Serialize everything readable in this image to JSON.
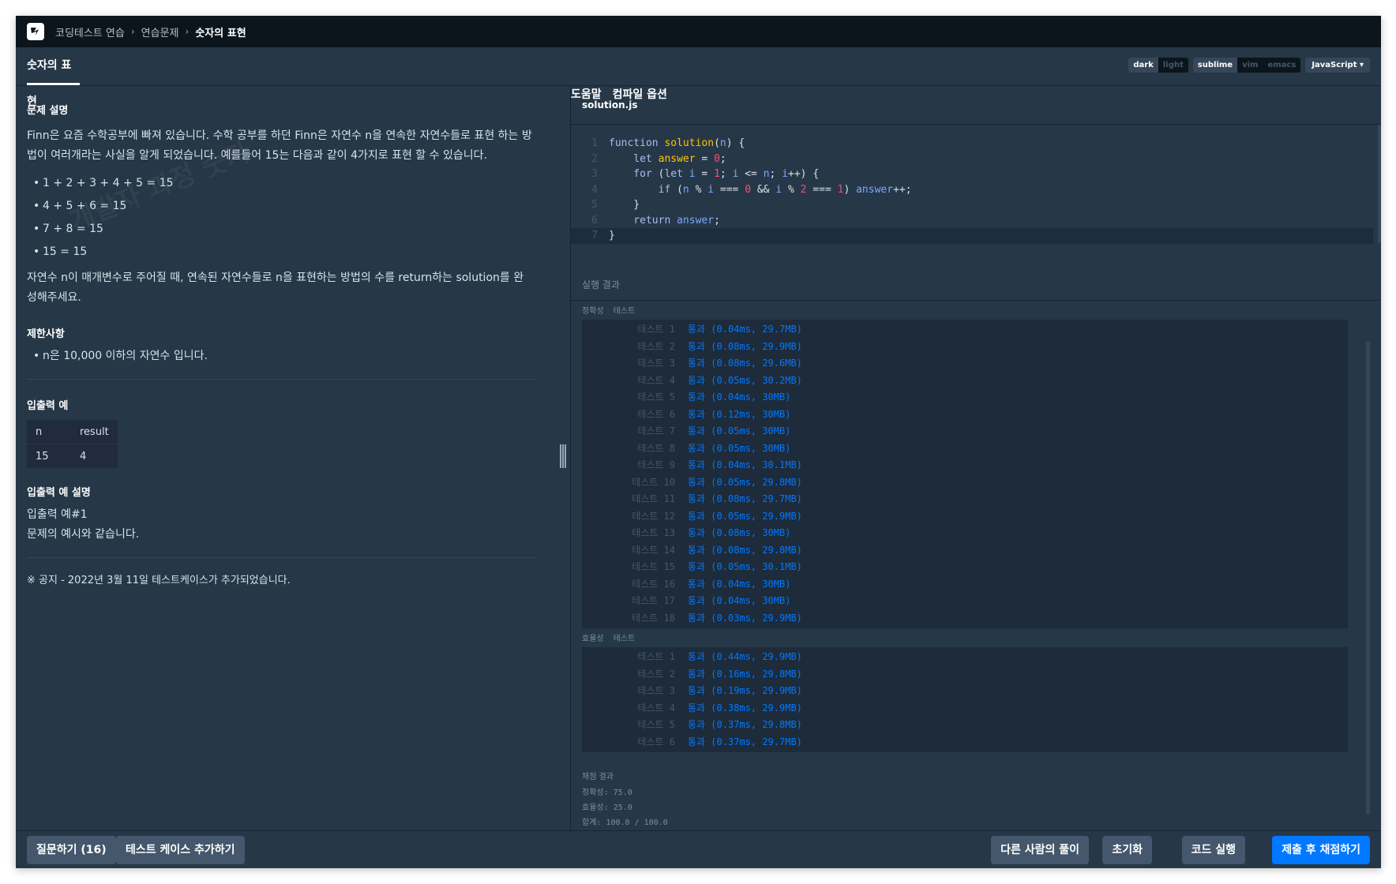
{
  "header": {
    "breadcrumbs": [
      "코딩테스트 연습",
      "연습문제",
      "숫자의 표현"
    ],
    "help": "도움말",
    "compile_options": "컴파일 옵션"
  },
  "tab": {
    "title": "숫자의 표현"
  },
  "editor_options": {
    "themes": [
      "dark",
      "light"
    ],
    "active_theme": "dark",
    "keymaps": [
      "sublime",
      "vim",
      "emacs"
    ],
    "active_keymap": "sublime",
    "language": "JavaScript"
  },
  "problem": {
    "desc_title": "문제 설명",
    "desc_text": "Finn은 요즘 수학공부에 빠져 있습니다. 수학 공부를 하던 Finn은 자연수 n을 연속한 자연수들로 표현 하는 방법이 여러개라는 사실을 알게 되었습니다. 예를들어 15는 다음과 같이 4가지로 표현 할 수 있습니다.",
    "examples": [
      "1 + 2 + 3 + 4 + 5 = 15",
      "4 + 5 + 6 = 15",
      "7 + 8 = 15",
      "15 = 15"
    ],
    "task_text": "자연수 n이 매개변수로 주어질 때, 연속된 자연수들로 n을 표현하는 방법의 수를 return하는 solution를 완성해주세요.",
    "constraints_title": "제한사항",
    "constraints": [
      "n은 10,000 이하의 자연수 입니다."
    ],
    "io_title": "입출력 예",
    "io_headers": [
      "n",
      "result"
    ],
    "io_rows": [
      [
        "15",
        "4"
      ]
    ],
    "io_explain_title": "입출력 예 설명",
    "io_explain_lines": [
      "입출력 예#1",
      "문제의 예시와 같습니다."
    ],
    "notice": "※ 공지 - 2022년 3월 11일 테스트케이스가 추가되었습니다."
  },
  "file": {
    "name": "solution.js"
  },
  "code_lines": [
    "function solution(n) {",
    "    let answer = 0;",
    "    for (let i = 1; i <= n; i++) {",
    "        if (n % i === 0 && i % 2 === 1) answer++;",
    "    }",
    "    return answer;",
    "}"
  ],
  "results": {
    "title": "실행 결과",
    "accuracy_label": [
      "정확성",
      "테스트"
    ],
    "efficiency_label": [
      "효율성",
      "테스트"
    ],
    "accuracy_tests": [
      {
        "label": "테스트 1",
        "result": "통과 (0.04ms, 29.7MB)"
      },
      {
        "label": "테스트 2",
        "result": "통과 (0.08ms, 29.9MB)"
      },
      {
        "label": "테스트 3",
        "result": "통과 (0.08ms, 29.6MB)"
      },
      {
        "label": "테스트 4",
        "result": "통과 (0.05ms, 30.2MB)"
      },
      {
        "label": "테스트 5",
        "result": "통과 (0.04ms, 30MB)"
      },
      {
        "label": "테스트 6",
        "result": "통과 (0.12ms, 30MB)"
      },
      {
        "label": "테스트 7",
        "result": "통과 (0.05ms, 30MB)"
      },
      {
        "label": "테스트 8",
        "result": "통과 (0.05ms, 30MB)"
      },
      {
        "label": "테스트 9",
        "result": "통과 (0.04ms, 30.1MB)"
      },
      {
        "label": "테스트 10",
        "result": "통과 (0.05ms, 29.8MB)"
      },
      {
        "label": "테스트 11",
        "result": "통과 (0.08ms, 29.7MB)"
      },
      {
        "label": "테스트 12",
        "result": "통과 (0.05ms, 29.9MB)"
      },
      {
        "label": "테스트 13",
        "result": "통과 (0.08ms, 30MB)"
      },
      {
        "label": "테스트 14",
        "result": "통과 (0.08ms, 29.8MB)"
      },
      {
        "label": "테스트 15",
        "result": "통과 (0.05ms, 30.1MB)"
      },
      {
        "label": "테스트 16",
        "result": "통과 (0.04ms, 30MB)"
      },
      {
        "label": "테스트 17",
        "result": "통과 (0.04ms, 30MB)"
      },
      {
        "label": "테스트 18",
        "result": "통과 (0.03ms, 29.9MB)"
      }
    ],
    "efficiency_tests": [
      {
        "label": "테스트 1",
        "result": "통과 (0.44ms, 29.9MB)"
      },
      {
        "label": "테스트 2",
        "result": "통과 (0.16ms, 29.8MB)"
      },
      {
        "label": "테스트 3",
        "result": "통과 (0.19ms, 29.9MB)"
      },
      {
        "label": "테스트 4",
        "result": "통과 (0.38ms, 29.9MB)"
      },
      {
        "label": "테스트 5",
        "result": "통과 (0.37ms, 29.8MB)"
      },
      {
        "label": "테스트 6",
        "result": "통과 (0.37ms, 29.7MB)"
      }
    ],
    "grade_title": "채점 결과",
    "grade_lines": [
      "정확성: 75.0",
      "효율성: 25.0",
      "합계: 100.0 / 100.0"
    ]
  },
  "buttons": {
    "ask": "질문하기 (16)",
    "add_testcase": "테스트 케이스 추가하기",
    "others": "다른 사람의 풀이",
    "reset": "초기화",
    "run": "코드 실행",
    "submit": "제출 후 채점하기"
  },
  "colors": {
    "background": "#263747",
    "header": "#0c151c",
    "accent": "#0078ff",
    "button": "#44576c"
  }
}
